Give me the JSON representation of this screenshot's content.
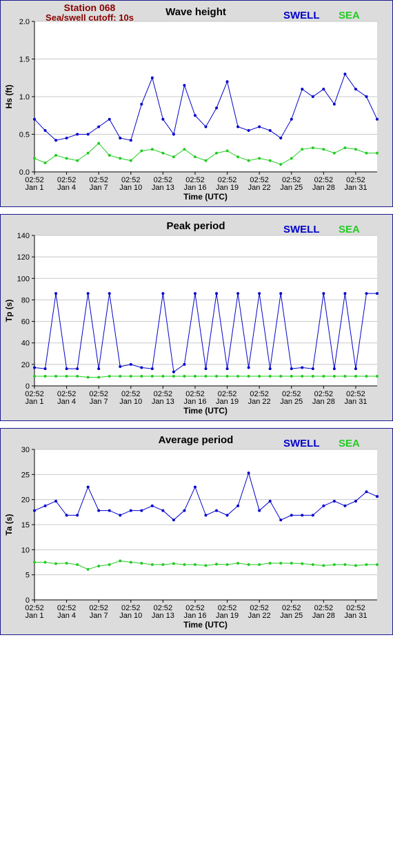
{
  "header": {
    "station": "Station 068",
    "cutoff": "Sea/swell cutoff: 10s"
  },
  "legend": {
    "swell": "SWELL",
    "sea": "SEA"
  },
  "colors": {
    "swell": "#0000cc",
    "sea": "#22cc22",
    "background": "#dcdcdc",
    "border": "#1a1a8c"
  },
  "x_ticks": [
    {
      "time": "02:52",
      "date": "Jan 1"
    },
    {
      "time": "02:52",
      "date": "Jan 4"
    },
    {
      "time": "02:52",
      "date": "Jan 7"
    },
    {
      "time": "02:52",
      "date": "Jan 10"
    },
    {
      "time": "02:52",
      "date": "Jan 13"
    },
    {
      "time": "02:52",
      "date": "Jan 16"
    },
    {
      "time": "02:52",
      "date": "Jan 19"
    },
    {
      "time": "02:52",
      "date": "Jan 22"
    },
    {
      "time": "02:52",
      "date": "Jan 25"
    },
    {
      "time": "02:52",
      "date": "Jan 28"
    },
    {
      "time": "02:52",
      "date": "Jan 31"
    }
  ],
  "chart_data": [
    {
      "type": "line",
      "title": "Wave height",
      "xlabel": "Time (UTC)",
      "ylabel": "Hs (ft)",
      "ylim": [
        0,
        2.0
      ],
      "yticks": [
        "0.0",
        "0.5",
        "1.0",
        "1.5",
        "2.0"
      ],
      "grid": true,
      "x_days": [
        0,
        1,
        2,
        3,
        4,
        5,
        6,
        7,
        8,
        9,
        10,
        11,
        12,
        13,
        14,
        15,
        16,
        17,
        18,
        19,
        20,
        21,
        22,
        23,
        24,
        25,
        26,
        27,
        28,
        29,
        30,
        31,
        32
      ],
      "series": [
        {
          "name": "SWELL",
          "values": [
            0.7,
            0.55,
            0.42,
            0.45,
            0.5,
            0.5,
            0.6,
            0.7,
            0.45,
            0.42,
            0.9,
            1.25,
            0.7,
            0.5,
            1.15,
            0.75,
            0.6,
            0.85,
            1.2,
            0.6,
            0.55,
            0.6,
            0.55,
            0.45,
            0.7,
            1.1,
            1.0,
            1.1,
            0.9,
            1.3,
            1.1,
            1.0,
            0.7
          ]
        },
        {
          "name": "SEA",
          "values": [
            0.18,
            0.12,
            0.22,
            0.18,
            0.15,
            0.25,
            0.38,
            0.22,
            0.18,
            0.15,
            0.28,
            0.3,
            0.25,
            0.2,
            0.3,
            0.2,
            0.15,
            0.25,
            0.28,
            0.2,
            0.15,
            0.18,
            0.15,
            0.1,
            0.18,
            0.3,
            0.32,
            0.3,
            0.25,
            0.32,
            0.3,
            0.25,
            0.25
          ]
        }
      ]
    },
    {
      "type": "line",
      "title": "Peak period",
      "xlabel": "Time (UTC)",
      "ylabel": "Tp (s)",
      "ylim": [
        0,
        140
      ],
      "yticks": [
        "0",
        "20",
        "40",
        "60",
        "80",
        "100",
        "120",
        "140"
      ],
      "grid": true,
      "x_days": [
        0,
        1,
        2,
        3,
        4,
        5,
        6,
        7,
        8,
        9,
        10,
        11,
        12,
        13,
        14,
        15,
        16,
        17,
        18,
        19,
        20,
        21,
        22,
        23,
        24,
        25,
        26,
        27,
        28,
        29,
        30,
        31,
        32
      ],
      "series": [
        {
          "name": "SWELL",
          "values": [
            17,
            16,
            86,
            16,
            16,
            86,
            16,
            86,
            18,
            20,
            17,
            16,
            86,
            13,
            20,
            86,
            16,
            86,
            16,
            86,
            17,
            86,
            16,
            86,
            16,
            17,
            16,
            86,
            16,
            86,
            16,
            86,
            86
          ]
        },
        {
          "name": "SEA",
          "values": [
            9,
            9,
            9,
            9,
            9,
            8,
            8,
            9,
            9,
            9,
            9,
            9,
            9,
            9,
            9,
            9,
            9,
            9,
            9,
            9,
            9,
            9,
            9,
            9,
            9,
            9,
            9,
            9,
            9,
            9,
            9,
            9,
            9
          ]
        }
      ]
    },
    {
      "type": "line",
      "title": "Average period",
      "xlabel": "Time (UTC)",
      "ylabel": "Ta (s)",
      "ylim": [
        0,
        32
      ],
      "yticks": [
        "0",
        "5",
        "10",
        "15",
        "20",
        "25",
        "30"
      ],
      "grid": true,
      "x_days": [
        0,
        1,
        2,
        3,
        4,
        5,
        6,
        7,
        8,
        9,
        10,
        11,
        12,
        13,
        14,
        15,
        16,
        17,
        18,
        19,
        20,
        21,
        22,
        23,
        24,
        25,
        26,
        27,
        28,
        29,
        30,
        31,
        32
      ],
      "series": [
        {
          "name": "SWELL",
          "values": [
            19,
            20,
            21,
            18,
            18,
            24,
            19,
            19,
            18,
            19,
            19,
            20,
            19,
            17,
            19,
            24,
            18,
            19,
            18,
            20,
            27,
            19,
            21,
            17,
            18,
            18,
            18,
            20,
            21,
            20,
            21,
            23,
            22
          ]
        },
        {
          "name": "SEA",
          "values": [
            8,
            8,
            7.7,
            7.8,
            7.5,
            6.5,
            7.2,
            7.5,
            8.3,
            8,
            7.8,
            7.5,
            7.5,
            7.7,
            7.5,
            7.5,
            7.3,
            7.6,
            7.5,
            7.8,
            7.5,
            7.5,
            7.8,
            7.8,
            7.8,
            7.7,
            7.5,
            7.3,
            7.5,
            7.5,
            7.3,
            7.5,
            7.5
          ]
        }
      ]
    }
  ]
}
